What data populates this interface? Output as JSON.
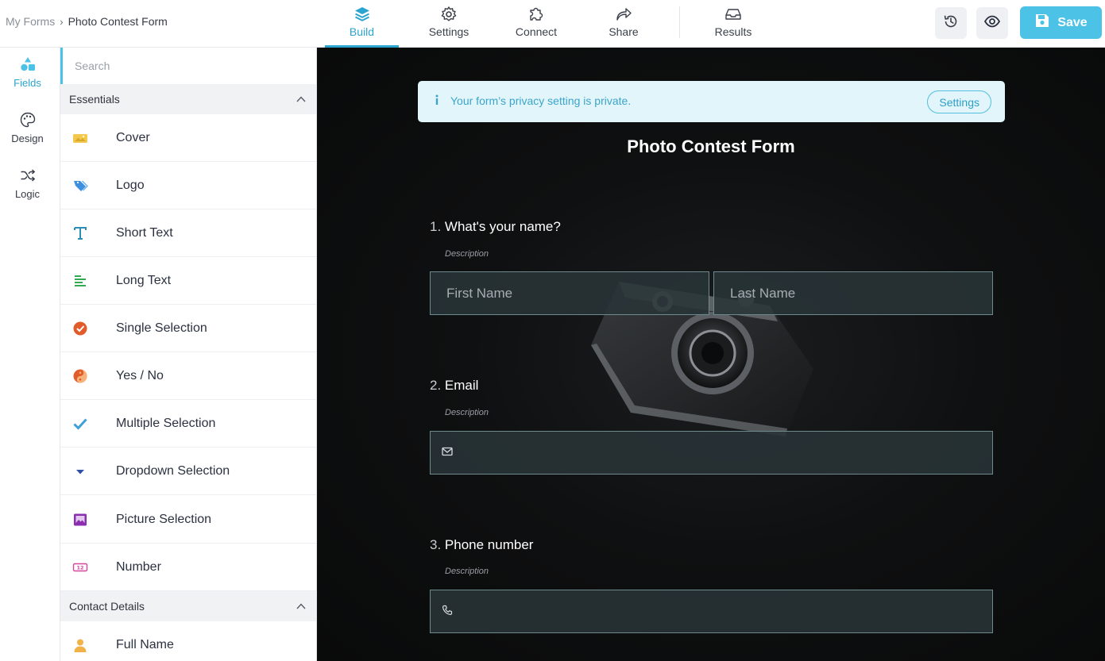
{
  "breadcrumb": {
    "root": "My Forms",
    "separator": "›",
    "current": "Photo Contest Form"
  },
  "nav": {
    "build": "Build",
    "settings": "Settings",
    "connect": "Connect",
    "share": "Share",
    "results": "Results"
  },
  "actions": {
    "save_label": "Save"
  },
  "rail": {
    "fields": "Fields",
    "design": "Design",
    "logic": "Logic"
  },
  "panel": {
    "search_placeholder": "Search",
    "essentials_title": "Essentials",
    "essentials": [
      {
        "label": "Cover",
        "icon": "cover-icon"
      },
      {
        "label": "Logo",
        "icon": "logo-tag-icon"
      },
      {
        "label": "Short Text",
        "icon": "short-text-icon"
      },
      {
        "label": "Long Text",
        "icon": "long-text-icon"
      },
      {
        "label": "Single Selection",
        "icon": "single-selection-icon"
      },
      {
        "label": "Yes / No",
        "icon": "yes-no-icon"
      },
      {
        "label": "Multiple Selection",
        "icon": "checkmark-icon"
      },
      {
        "label": "Dropdown Selection",
        "icon": "dropdown-icon"
      },
      {
        "label": "Picture Selection",
        "icon": "picture-icon"
      },
      {
        "label": "Number",
        "icon": "number-icon"
      }
    ],
    "contact_title": "Contact Details",
    "contact": [
      {
        "label": "Full Name",
        "icon": "person-icon"
      }
    ]
  },
  "form": {
    "notice": "Your form’s privacy setting is private.",
    "notice_button": "Settings",
    "title": "Photo Contest Form",
    "questions": [
      {
        "number": "1.",
        "label": "What's your name?",
        "description": "Description",
        "first_placeholder": "First Name",
        "last_placeholder": "Last Name"
      },
      {
        "number": "2.",
        "label": "Email",
        "description": "Description"
      },
      {
        "number": "3.",
        "label": "Phone number",
        "description": "Description"
      }
    ]
  },
  "colors": {
    "accent": "#4cc2e6",
    "active_text": "#2ba4cf",
    "notice_bg": "#e1f5fb",
    "canvas_bg": "#0f1011"
  }
}
